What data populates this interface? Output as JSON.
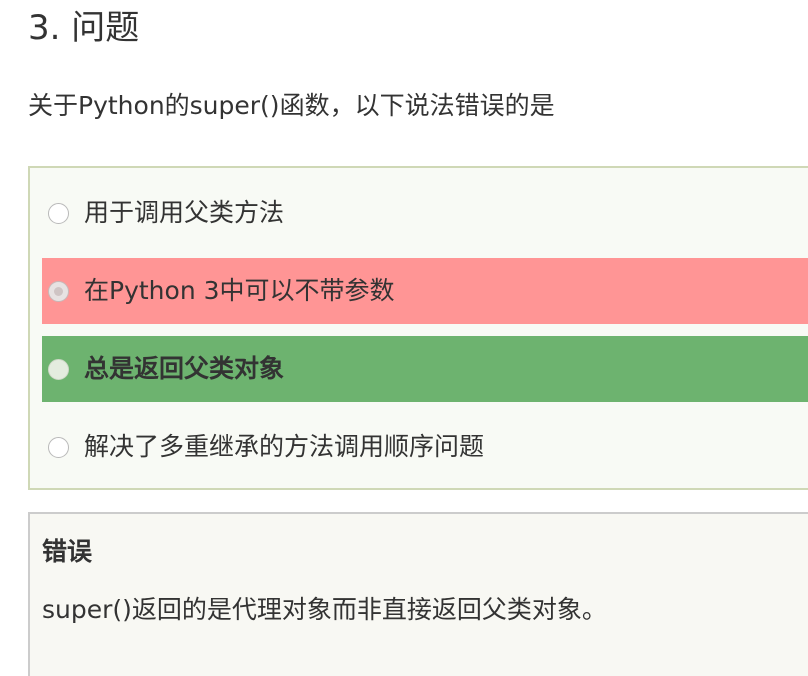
{
  "question": {
    "heading": "3. 问题",
    "text": "关于Python的super()函数，以下说法错误的是"
  },
  "options": [
    {
      "label": "用于调用父类方法",
      "state": "unselected"
    },
    {
      "label": "在Python 3中可以不带参数",
      "state": "selected-wrong"
    },
    {
      "label": "总是返回父类对象",
      "state": "correct"
    },
    {
      "label": "解决了多重继承的方法调用顺序问题",
      "state": "unselected"
    }
  ],
  "feedback": {
    "title": "错误",
    "text": "super()返回的是代理对象而非直接返回父类对象。"
  },
  "colors": {
    "wrong_highlight": "#ff9595",
    "correct_highlight": "#6db36f",
    "options_border": "#cfd8b6"
  }
}
